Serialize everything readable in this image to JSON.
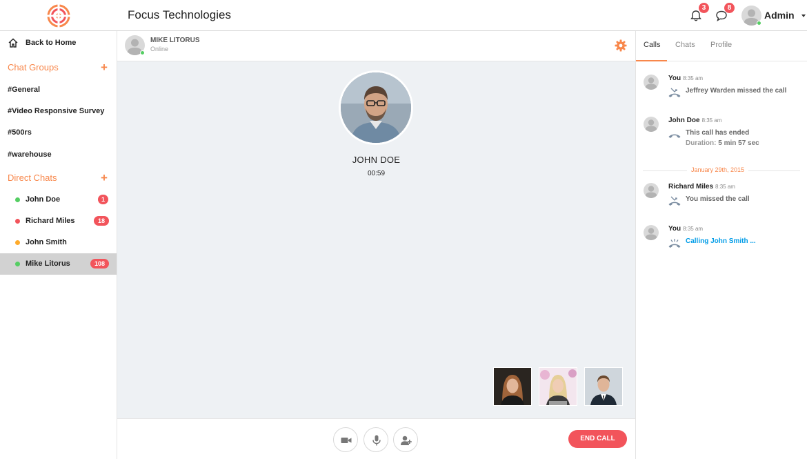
{
  "header": {
    "app_title": "Focus Technologies",
    "notifications_count": "3",
    "messages_count": "8",
    "user_name": "Admin"
  },
  "sidebar": {
    "back_label": "Back to Home",
    "chat_groups_title": "Chat Groups",
    "add_symbol": "+",
    "groups": [
      "#General",
      "#Video Responsive Survey",
      "#500rs",
      "#warehouse"
    ],
    "direct_chats_title": "Direct Chats",
    "direct_chats": [
      {
        "name": "John Doe",
        "status_color": "#55ce63",
        "badge": "1"
      },
      {
        "name": "Richard Miles",
        "status_color": "#f2545b",
        "badge": "18"
      },
      {
        "name": "John Smith",
        "status_color": "#ffab2b",
        "badge": ""
      },
      {
        "name": "Mike Litorus",
        "status_color": "#55ce63",
        "badge": "108"
      }
    ]
  },
  "chat": {
    "contact_name": "MIKE LITORUS",
    "contact_status": "Online"
  },
  "call": {
    "callee_name": "JOHN DOE",
    "timer": "00:59",
    "end_call_label": "END CALL"
  },
  "right_panel": {
    "tabs": [
      "Calls",
      "Chats",
      "Profile"
    ],
    "date_divider": "January 29th, 2015",
    "entries": [
      {
        "name": "You",
        "time": "8:35 am",
        "text": "Jeffrey Warden missed the call",
        "icon": "missed-call-icon"
      },
      {
        "name": "John Doe",
        "time": "8:35 am",
        "text": "This call has ended",
        "duration_label": "Duration:",
        "duration_value": "5 min 57 sec",
        "icon": "call-ended-icon"
      },
      {
        "name": "Richard Miles",
        "time": "8:35 am",
        "text": "You missed the call",
        "icon": "missed-call-icon"
      },
      {
        "name": "You",
        "time": "8:35 am",
        "text": "Calling John Smith ...",
        "icon": "calling-icon"
      }
    ]
  },
  "colors": {
    "accent": "#f8874b",
    "danger": "#f2545b",
    "online": "#55ce63",
    "link": "#009ce7"
  }
}
